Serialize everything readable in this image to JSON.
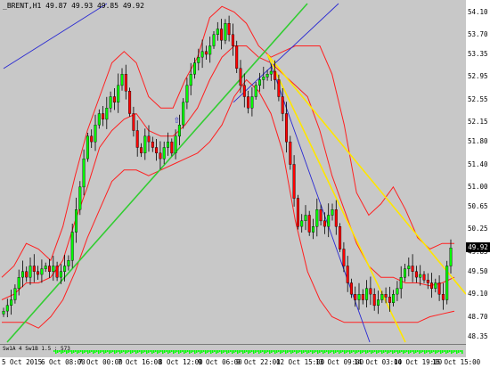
{
  "chart_header": {
    "symbol": "_BRENT,H1",
    "open": "49.87",
    "high": "49.93",
    "low": "49.85",
    "close": "49.92",
    "text": "_BRENT,H1  49.87 49.93 49.85 49.92"
  },
  "indicator": {
    "label": "Sw1A 4 Sw1B 1.5  : 573"
  },
  "colors": {
    "background": "#c8c8c8",
    "bull_candle": "#00ff00",
    "bear_candle": "#ff0000",
    "bollinger": "#ff2020",
    "trend_green": "#32cd32",
    "trend_blue": "#2a2ad2",
    "trend_yellow": "#ffe600"
  },
  "chart_data": {
    "type": "candlestick",
    "title": "_BRENT,H1",
    "y_axis_ticks": [
      "54.10",
      "53.70",
      "53.35",
      "52.95",
      "52.55",
      "52.15",
      "51.80",
      "51.40",
      "51.00",
      "50.65",
      "50.25",
      "49.85",
      "49.50",
      "49.10",
      "48.70",
      "48.35"
    ],
    "x_axis_ticks": [
      "5 Oct 2015",
      "6 Oct 08:00",
      "7 Oct 00:00",
      "7 Oct 16:00",
      "8 Oct 12:00",
      "9 Oct 06:00",
      "9 Oct 22:00",
      "12 Oct 15:00",
      "13 Oct 09:00",
      "14 Oct 03:00",
      "14 Oct 19:00",
      "15 Oct 15:00"
    ],
    "ylim": [
      48.25,
      54.25
    ],
    "last_price": "49.92",
    "series": [
      {
        "kind": "close",
        "values": [
          48.8,
          48.9,
          49.0,
          49.2,
          49.4,
          49.5,
          49.4,
          49.6,
          49.5,
          49.45,
          49.55,
          49.6,
          49.5,
          49.6,
          49.4,
          49.5,
          49.6,
          49.7,
          50.2,
          50.6,
          51.0,
          51.5,
          51.9,
          51.8,
          52.1,
          52.3,
          52.2,
          52.4,
          52.6,
          52.5,
          52.8,
          53.0,
          52.7,
          52.3,
          52.0,
          51.7,
          51.6,
          51.9,
          51.8,
          51.7,
          51.6,
          51.5,
          51.7,
          51.8,
          51.6,
          51.9,
          52.1,
          52.5,
          52.8,
          53.0,
          53.2,
          53.3,
          53.4,
          53.35,
          53.5,
          53.7,
          53.8,
          53.6,
          53.9,
          53.7,
          53.5,
          53.1,
          52.8,
          52.6,
          52.4,
          52.6,
          52.8,
          52.9,
          52.95,
          53.0,
          53.05,
          52.9,
          52.6,
          52.3,
          51.8,
          51.4,
          50.8,
          50.3,
          50.4,
          50.5,
          50.2,
          50.3,
          50.6,
          50.4,
          50.3,
          50.5,
          50.6,
          50.3,
          49.9,
          49.6,
          49.3,
          49.1,
          49.0,
          49.1,
          49.0,
          49.2,
          49.1,
          48.9,
          49.0,
          49.1,
          49.05,
          48.95,
          49.1,
          49.2,
          49.4,
          49.55,
          49.6,
          49.5,
          49.4,
          49.45,
          49.35,
          49.3,
          49.2,
          49.3,
          49.1,
          49.0,
          49.6,
          49.92
        ]
      },
      {
        "kind": "bollinger_upper",
        "values": [
          49.4,
          49.6,
          50.0,
          49.9,
          49.7,
          50.3,
          51.2,
          52.0,
          52.6,
          53.2,
          53.4,
          53.2,
          52.6,
          52.4,
          52.4,
          52.9,
          53.3,
          54.0,
          54.2,
          54.1,
          53.9,
          53.5,
          53.3,
          53.4,
          53.5,
          53.5,
          53.5,
          53.0,
          52.1,
          50.9,
          50.5,
          50.7,
          51.0,
          50.6,
          50.1,
          49.9,
          50.0,
          50.0
        ]
      },
      {
        "kind": "bollinger_middle",
        "values": [
          49.0,
          49.1,
          49.3,
          49.3,
          49.4,
          49.7,
          50.4,
          51.0,
          51.7,
          52.0,
          52.2,
          52.3,
          52.0,
          51.9,
          51.9,
          52.1,
          52.4,
          52.9,
          53.3,
          53.5,
          53.5,
          53.3,
          53.2,
          53.0,
          52.8,
          52.6,
          52.0,
          51.2,
          50.6,
          50.0,
          49.6,
          49.4,
          49.4,
          49.3,
          49.3,
          49.25,
          49.3,
          49.4
        ]
      },
      {
        "kind": "bollinger_lower",
        "values": [
          48.6,
          48.6,
          48.6,
          48.5,
          48.7,
          49.0,
          49.5,
          50.1,
          50.6,
          51.1,
          51.3,
          51.3,
          51.2,
          51.3,
          51.4,
          51.5,
          51.6,
          51.8,
          52.1,
          52.6,
          52.9,
          52.7,
          52.3,
          51.6,
          50.4,
          49.5,
          49.0,
          48.7,
          48.6,
          48.6,
          48.6,
          48.6,
          48.6,
          48.6,
          48.6,
          48.7,
          48.75,
          48.8
        ]
      }
    ],
    "trendlines": [
      {
        "color": "green",
        "from_price": 48.25,
        "to_price": 54.25
      },
      {
        "color": "blue",
        "from_price": 53.1,
        "to_price": 54.25
      },
      {
        "color": "blue",
        "from_price": 52.5,
        "to_price": 54.25
      },
      {
        "color": "blue",
        "from_price": 53.35,
        "to_price": 48.25
      },
      {
        "color": "yellow",
        "from_price": 53.35,
        "to_price": 48.25
      },
      {
        "color": "yellow",
        "from_price": 53.35,
        "to_price": 49.1
      }
    ],
    "grid": false
  }
}
